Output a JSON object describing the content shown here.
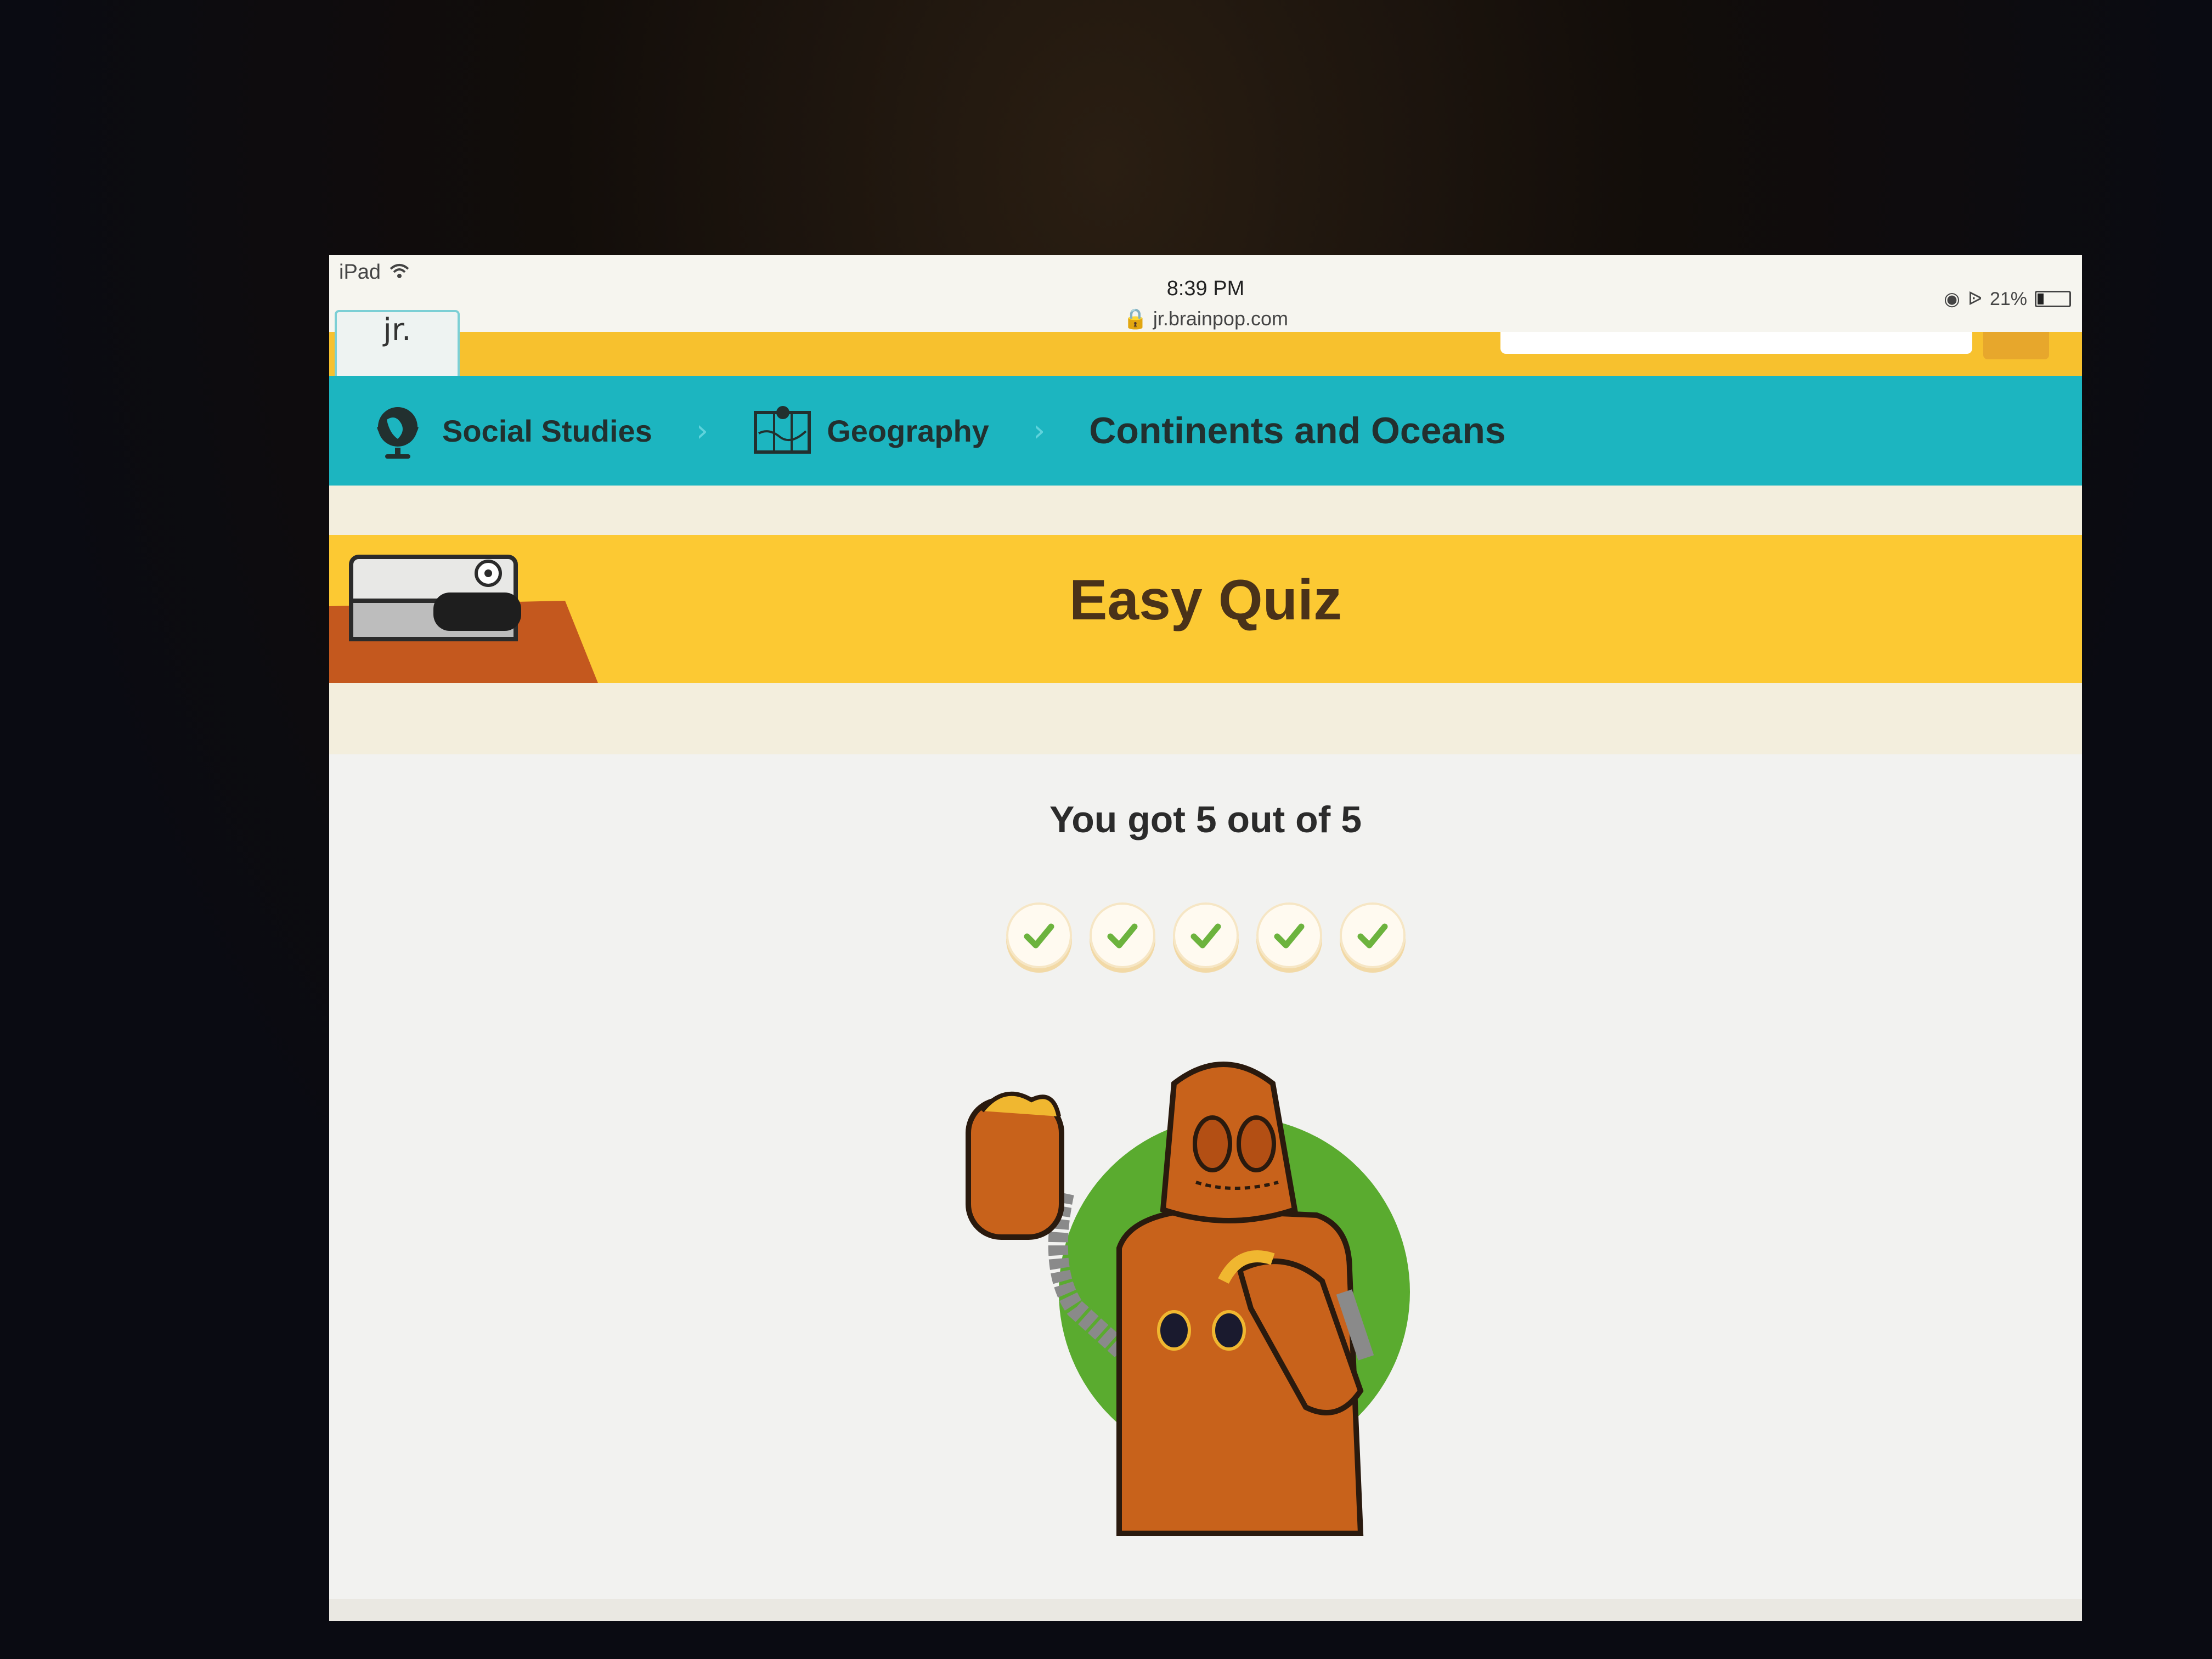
{
  "status_bar": {
    "device": "iPad",
    "time": "8:39 PM",
    "url": "jr.brainpop.com",
    "battery": "21%",
    "battery_level": 0.21
  },
  "header": {
    "logo_text": "jr."
  },
  "breadcrumb": {
    "items": [
      {
        "label": "Social Studies",
        "icon": "globe-icon"
      },
      {
        "label": "Geography",
        "icon": "map-icon"
      },
      {
        "label": "Continents and Oceans"
      }
    ]
  },
  "quiz": {
    "title": "Easy Quiz",
    "score_text": "You got 5 out of 5",
    "correct": 5,
    "total": 5
  },
  "colors": {
    "header_yellow": "#f7c12e",
    "breadcrumb_teal": "#1cb5c0",
    "banner_yellow": "#fcc933",
    "check_green": "#6cb33e",
    "moby_orange": "#c8621b",
    "moby_circle_green": "#5aab2f"
  }
}
